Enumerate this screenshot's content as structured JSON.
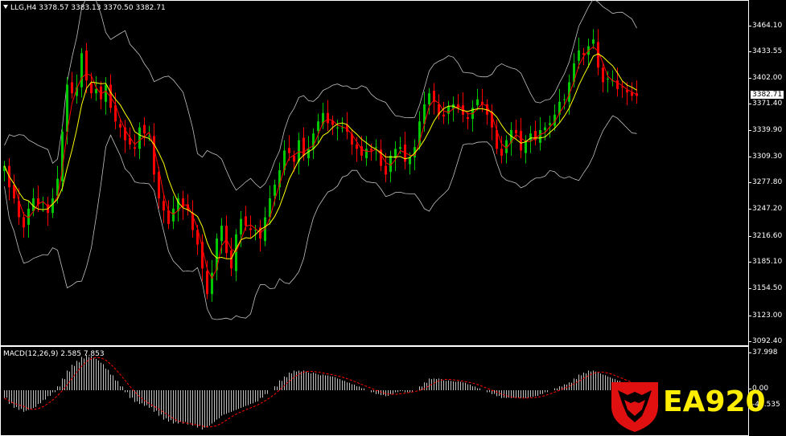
{
  "chart": {
    "symbol_line": "LLG,H4  3378.57 3383.13 3370.50 3382.71",
    "current_price": "3382.71",
    "price_ticks": [
      "3464.10",
      "3433.55",
      "3402.00",
      "3371.40",
      "3339.90",
      "3309.30",
      "3277.80",
      "3247.20",
      "3216.60",
      "3185.10",
      "3154.50",
      "3123.00",
      "3092.40"
    ],
    "macd_label": "MACD(12,26,9) 2.585 7.853",
    "macd_ticks": [
      "37.998",
      "0.00",
      "-40.535"
    ],
    "colors": {
      "bull": "#00c800",
      "bear": "#ff0000",
      "ma_fast": "#ff0000",
      "ma_slow": "#ffff00",
      "bands": "#c0c0c0",
      "signal": "#ff0000",
      "histogram": "#c0c0c0"
    }
  },
  "chart_data": {
    "type": "line",
    "title": "LLG,H4",
    "ohlc_last": {
      "open": 3378.57,
      "high": 3383.13,
      "low": 3370.5,
      "close": 3382.71
    },
    "x": [
      0,
      6,
      12,
      18,
      24,
      30,
      36,
      42,
      48,
      54,
      60,
      66,
      72,
      78,
      84,
      90,
      96,
      102,
      108,
      114,
      120,
      126,
      132,
      138,
      144,
      150,
      156,
      162,
      168,
      174,
      180,
      186,
      192,
      198,
      204,
      210,
      216,
      222,
      228,
      234,
      240,
      246,
      252,
      258,
      264,
      270,
      276,
      282,
      288,
      294,
      300,
      306,
      312,
      318,
      324,
      330,
      336,
      342,
      348,
      354,
      360,
      366,
      372,
      378,
      384,
      390,
      396,
      402,
      408,
      414,
      420,
      426,
      432,
      438,
      444,
      450,
      456,
      462,
      468,
      474,
      480,
      486,
      492,
      498,
      504,
      510,
      516,
      522,
      528,
      534,
      540,
      546,
      552,
      558,
      564,
      570,
      576,
      582,
      588,
      594,
      600,
      606,
      612,
      618,
      624,
      630,
      636,
      642,
      648,
      654,
      660,
      666,
      672,
      678,
      684,
      690,
      696,
      702,
      708,
      714,
      720,
      726,
      732,
      738,
      744,
      750,
      756,
      762,
      768,
      774,
      780,
      786,
      792,
      798,
      804,
      810,
      816,
      822
    ],
    "close": [
      3300,
      3275,
      3262,
      3240,
      3228,
      3250,
      3262,
      3255,
      3258,
      3245,
      3262,
      3285,
      3340,
      3395,
      3385,
      3392,
      3432,
      3400,
      3385,
      3390,
      3378,
      3395,
      3368,
      3352,
      3345,
      3330,
      3325,
      3320,
      3345,
      3338,
      3335,
      3290,
      3262,
      3248,
      3232,
      3250,
      3262,
      3252,
      3248,
      3225,
      3208,
      3180,
      3150,
      3175,
      3215,
      3230,
      3198,
      3180,
      3220,
      3238,
      3230,
      3225,
      3225,
      3215,
      3240,
      3262,
      3278,
      3295,
      3318,
      3315,
      3305,
      3330,
      3312,
      3320,
      3338,
      3352,
      3362,
      3350,
      3348,
      3345,
      3345,
      3340,
      3325,
      3320,
      3312,
      3320,
      3318,
      3322,
      3300,
      3290,
      3312,
      3320,
      3322,
      3305,
      3310,
      3322,
      3352,
      3372,
      3385,
      3375,
      3360,
      3358,
      3370,
      3372,
      3368,
      3360,
      3355,
      3368,
      3378,
      3372,
      3360,
      3345,
      3320,
      3312,
      3330,
      3342,
      3338,
      3318,
      3330,
      3338,
      3330,
      3342,
      3345,
      3350,
      3360,
      3375,
      3378,
      3398,
      3420,
      3435,
      3430,
      3440,
      3448,
      3415,
      3398,
      3402,
      3400,
      3390,
      3392,
      3386,
      3382,
      3382
    ],
    "macd_hist": [
      -8,
      -14,
      -18,
      -20,
      -22,
      -20,
      -18,
      -14,
      -10,
      -6,
      -2,
      4,
      12,
      20,
      26,
      30,
      34,
      36,
      35,
      32,
      28,
      22,
      16,
      10,
      4,
      -2,
      -8,
      -12,
      -14,
      -16,
      -18,
      -22,
      -26,
      -30,
      -32,
      -34,
      -34,
      -34,
      -35,
      -36,
      -38,
      -40,
      -38,
      -34,
      -30,
      -26,
      -24,
      -22,
      -20,
      -18,
      -16,
      -14,
      -12,
      -8,
      -4,
      0,
      4,
      10,
      14,
      18,
      20,
      20,
      20,
      18,
      18,
      16,
      16,
      15,
      14,
      12,
      10,
      8,
      6,
      4,
      2,
      0,
      -2,
      -4,
      -5,
      -6,
      -4,
      -2,
      -1,
      -2,
      -2,
      0,
      4,
      8,
      12,
      12,
      12,
      10,
      10,
      9,
      9,
      8,
      6,
      4,
      2,
      0,
      -2,
      -4,
      -6,
      -8,
      -8,
      -8,
      -8,
      -8,
      -8,
      -7,
      -6,
      -4,
      -2,
      0,
      2,
      4,
      6,
      8,
      12,
      16,
      18,
      20,
      20,
      18,
      16,
      14,
      12,
      10,
      8,
      6,
      4,
      2,
      2,
      2
    ]
  }
}
